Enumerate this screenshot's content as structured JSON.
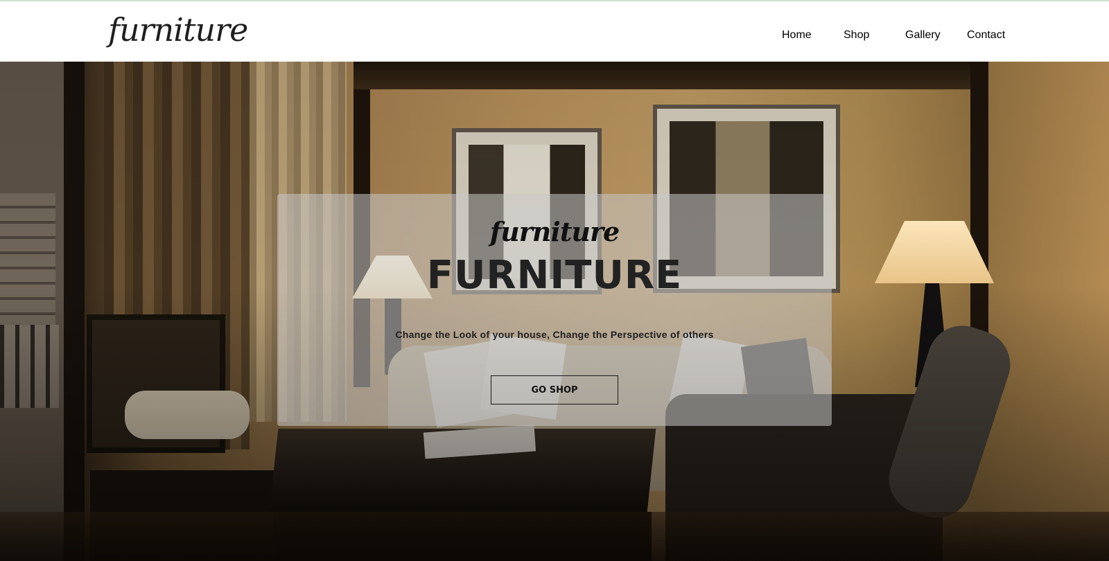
{
  "header": {
    "logo": "furniture",
    "nav": [
      {
        "label": "Home"
      },
      {
        "label": "Shop"
      },
      {
        "label": "Gallery"
      },
      {
        "label": "Contact"
      }
    ]
  },
  "hero": {
    "background": "living room interior photo with lamps, framed pictures, sofa and armchairs",
    "panel": {
      "script_title": "furniture",
      "title": "FURNITURE",
      "tagline": "Change the Look of your house, Change the Perspective of others",
      "button_label": "GO SHOP"
    }
  },
  "colors": {
    "header_bg": "#ffffff",
    "text_dark": "#222222",
    "panel_overlay": "rgba(200,200,200,0.55)"
  }
}
